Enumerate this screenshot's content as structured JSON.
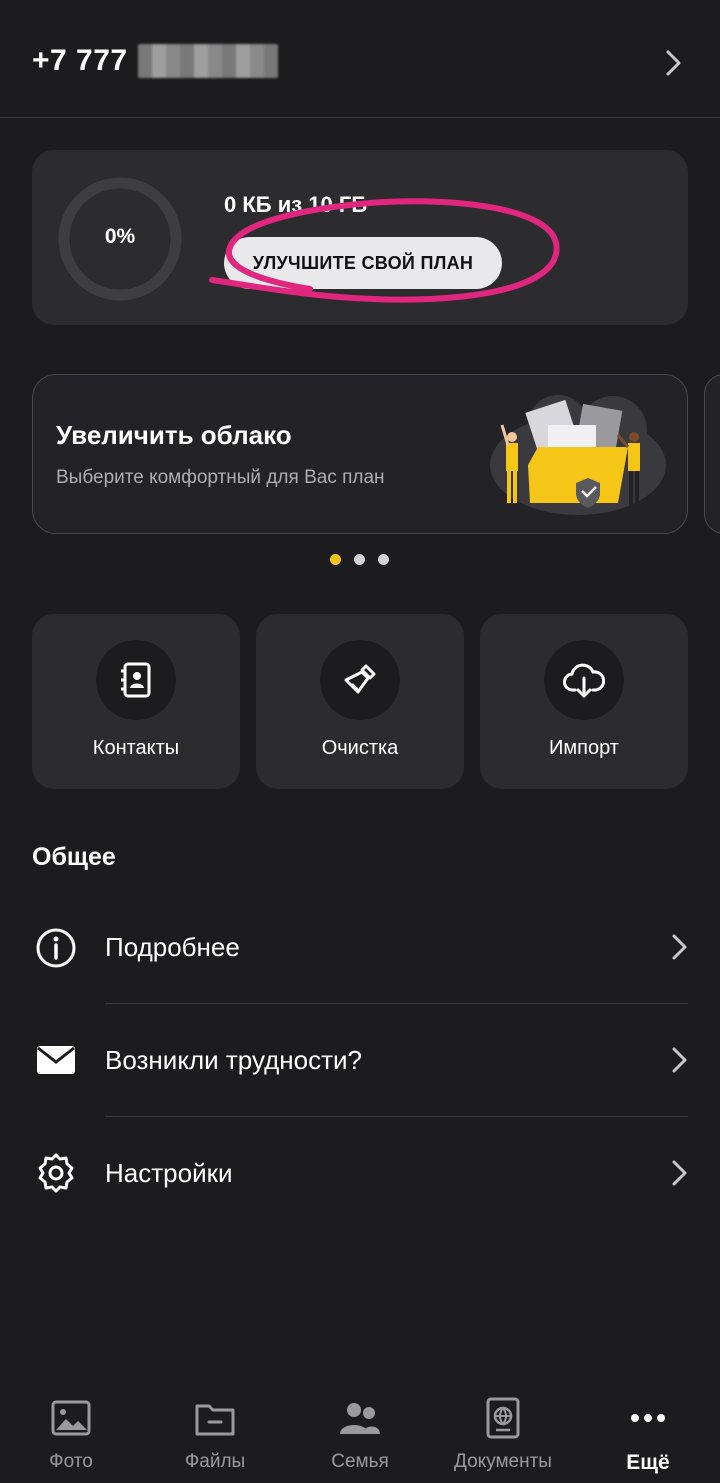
{
  "header": {
    "phone_visible": "+7 777"
  },
  "storage": {
    "percent_label": "0%",
    "percent_value": 0,
    "usage_text": "0 КБ из 10 ГБ",
    "upgrade_label": "УЛУЧШИТЕ СВОЙ ПЛАН"
  },
  "promo": {
    "title": "Увеличить облако",
    "subtitle": "Выберите комфортный для Вас план",
    "page_count": 3,
    "active_index": 0
  },
  "tiles": [
    {
      "label": "Контакты",
      "icon": "contacts-icon"
    },
    {
      "label": "Очистка",
      "icon": "broom-icon"
    },
    {
      "label": "Импорт",
      "icon": "cloud-download-icon"
    }
  ],
  "general": {
    "title": "Общее",
    "items": [
      {
        "label": "Подробнее",
        "icon": "info-icon"
      },
      {
        "label": "Возникли трудности?",
        "icon": "mail-icon"
      },
      {
        "label": "Настройки",
        "icon": "gear-icon"
      }
    ]
  },
  "nav": {
    "items": [
      {
        "label": "Фото",
        "icon": "photo-icon"
      },
      {
        "label": "Файлы",
        "icon": "folder-icon"
      },
      {
        "label": "Семья",
        "icon": "family-icon"
      },
      {
        "label": "Документы",
        "icon": "passport-icon"
      },
      {
        "label": "Ещё",
        "icon": "more-icon"
      }
    ],
    "active": "Ещё"
  },
  "colors": {
    "background": "#1c1c1e",
    "card": "#2c2c2e",
    "accent_yellow": "#f5c518",
    "annotation": "#e0267e"
  }
}
